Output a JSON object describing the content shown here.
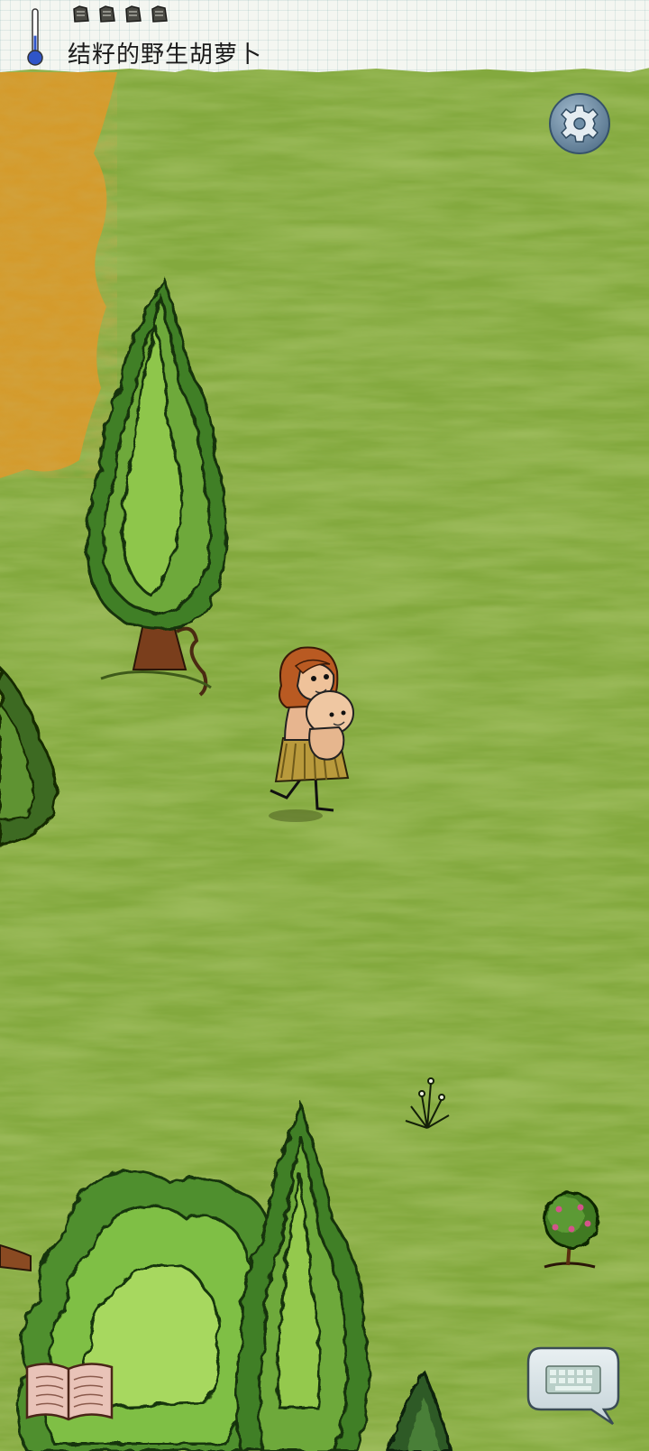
{
  "hud": {
    "status_text": "结籽的野生胡萝卜",
    "food_pips_filled": 4,
    "temperature_level": 0.4,
    "thermometer_icon": "thermometer-icon"
  },
  "controls": {
    "settings_icon": "gear-icon",
    "book_icon": "open-book-icon",
    "chat_icon": "keyboard-chat-icon"
  },
  "colors": {
    "grass": "#7fa83c",
    "dry_grass": "#d39a2a",
    "paper": "#f4f6f1",
    "thermometer_blue": "#2f55c8",
    "ui_button": "#6f8fa8"
  }
}
